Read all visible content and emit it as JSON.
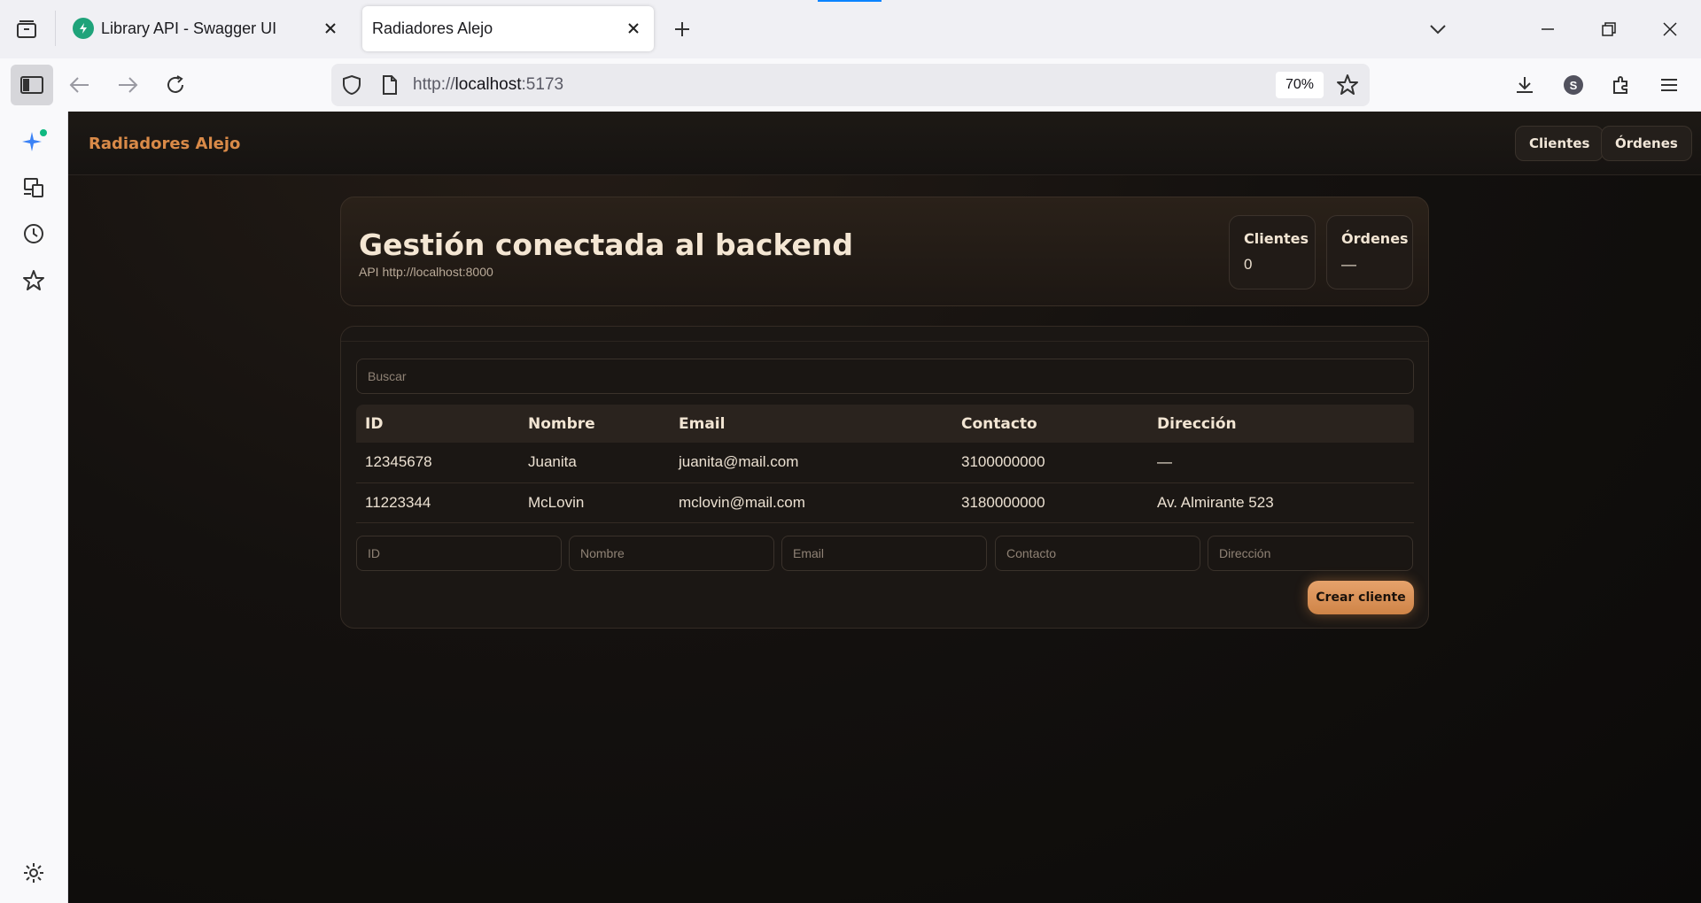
{
  "browser": {
    "tabs": [
      {
        "title": "Library API - Swagger UI"
      },
      {
        "title": "Radiadores Alejo"
      }
    ],
    "url_scheme": "http://",
    "url_host": "localhost",
    "url_port": ":5173",
    "zoom": "70%",
    "profile_initial": "S"
  },
  "app": {
    "brand": "Radiadores Alejo",
    "nav": {
      "clientes": "Clientes",
      "ordenes": "Órdenes"
    },
    "hero": {
      "title": "Gestión conectada al backend",
      "subtitle": "API http://localhost:8000",
      "stats": [
        {
          "label": "Clientes",
          "value": "0"
        },
        {
          "label": "Órdenes",
          "value": "—"
        }
      ]
    },
    "search": {
      "placeholder": "Buscar"
    },
    "table": {
      "headers": [
        "ID",
        "Nombre",
        "Email",
        "Contacto",
        "Dirección"
      ],
      "rows": [
        [
          "12345678",
          "Juanita",
          "juanita@mail.com",
          "3100000000",
          "—"
        ],
        [
          "11223344",
          "McLovin",
          "mclovin@mail.com",
          "3180000000",
          "Av. Almirante 523"
        ]
      ]
    },
    "form": {
      "placeholders": {
        "id": "ID",
        "nombre": "Nombre",
        "email": "Email",
        "contacto": "Contacto",
        "direccion": "Dirección"
      },
      "submit": "Crear cliente"
    }
  }
}
